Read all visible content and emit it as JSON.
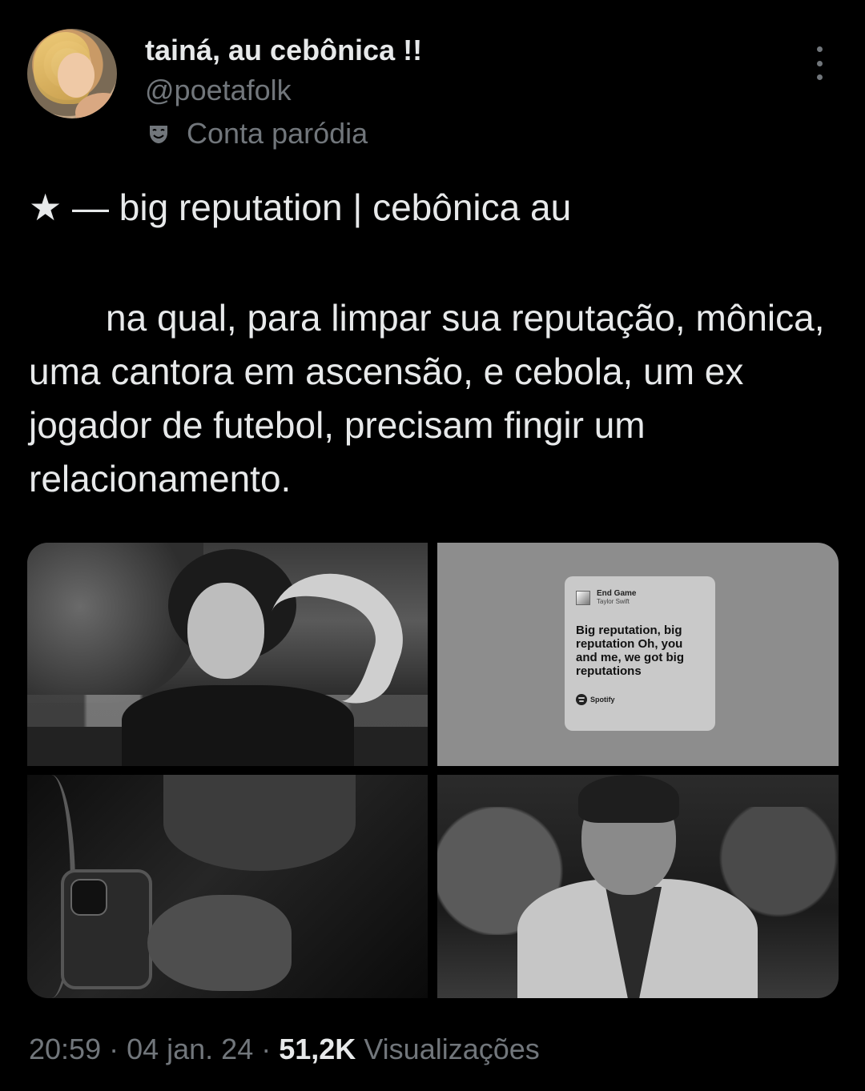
{
  "author": {
    "display_name": "tainá, au cebônica !!",
    "handle": "@poetafolk",
    "parody_label": "Conta paródia"
  },
  "tweet": {
    "title": "★ — big reputation | cebônica au",
    "body": "na qual, para limpar sua reputação, mônica, uma cantora em ascensão, e cebola, um ex jogador de futebol, precisam fingir um relacionamento."
  },
  "media": {
    "lyric_card": {
      "song": "End Game",
      "artist": "Taylor Swift",
      "lyrics": "Big reputation, big reputation Oh, you and me, we got big reputations",
      "brand": "Spotify"
    }
  },
  "meta": {
    "time": "20:59",
    "date": "04 jan. 24",
    "views_count": "51,2K",
    "views_label": "Visualizações",
    "separator": "·"
  },
  "icons": {
    "parody": "theater-mask-icon",
    "more": "more-vertical-icon",
    "spotify": "spotify-icon"
  },
  "colors": {
    "background": "#000000",
    "text_primary": "#e7e9ea",
    "text_secondary": "#71767b"
  }
}
